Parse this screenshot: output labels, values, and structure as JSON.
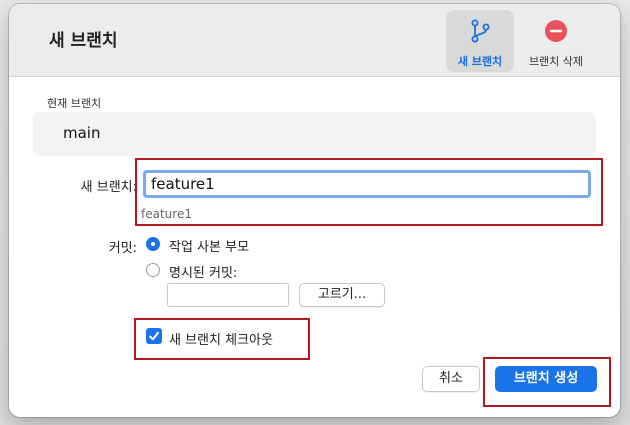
{
  "dialog": {
    "title": "새 브랜치"
  },
  "toolbar": {
    "new_branch_label": "새 브랜치",
    "delete_branch_label": "브랜치 삭제",
    "new_branch_icon": "branch-icon",
    "delete_branch_icon": "minus-circle-icon",
    "accent_color": "#1a6fe0",
    "delete_color": "#e8525f"
  },
  "current_branch": {
    "label": "현재 브랜치",
    "value": "main"
  },
  "new_branch": {
    "label": "새 브랜치:",
    "value": "feature1",
    "hint": "feature1"
  },
  "commit": {
    "label": "커밋:",
    "options": [
      {
        "label": "작업 사본 부모",
        "selected": true
      },
      {
        "label": "명시된 커밋:",
        "selected": false
      }
    ],
    "specified_value": "",
    "choose_button": "고르기..."
  },
  "checkout": {
    "label": "새 브랜치 체크아웃",
    "checked": true
  },
  "buttons": {
    "cancel": "취소",
    "create": "브랜치 생성"
  },
  "highlight_color": "#b51820"
}
